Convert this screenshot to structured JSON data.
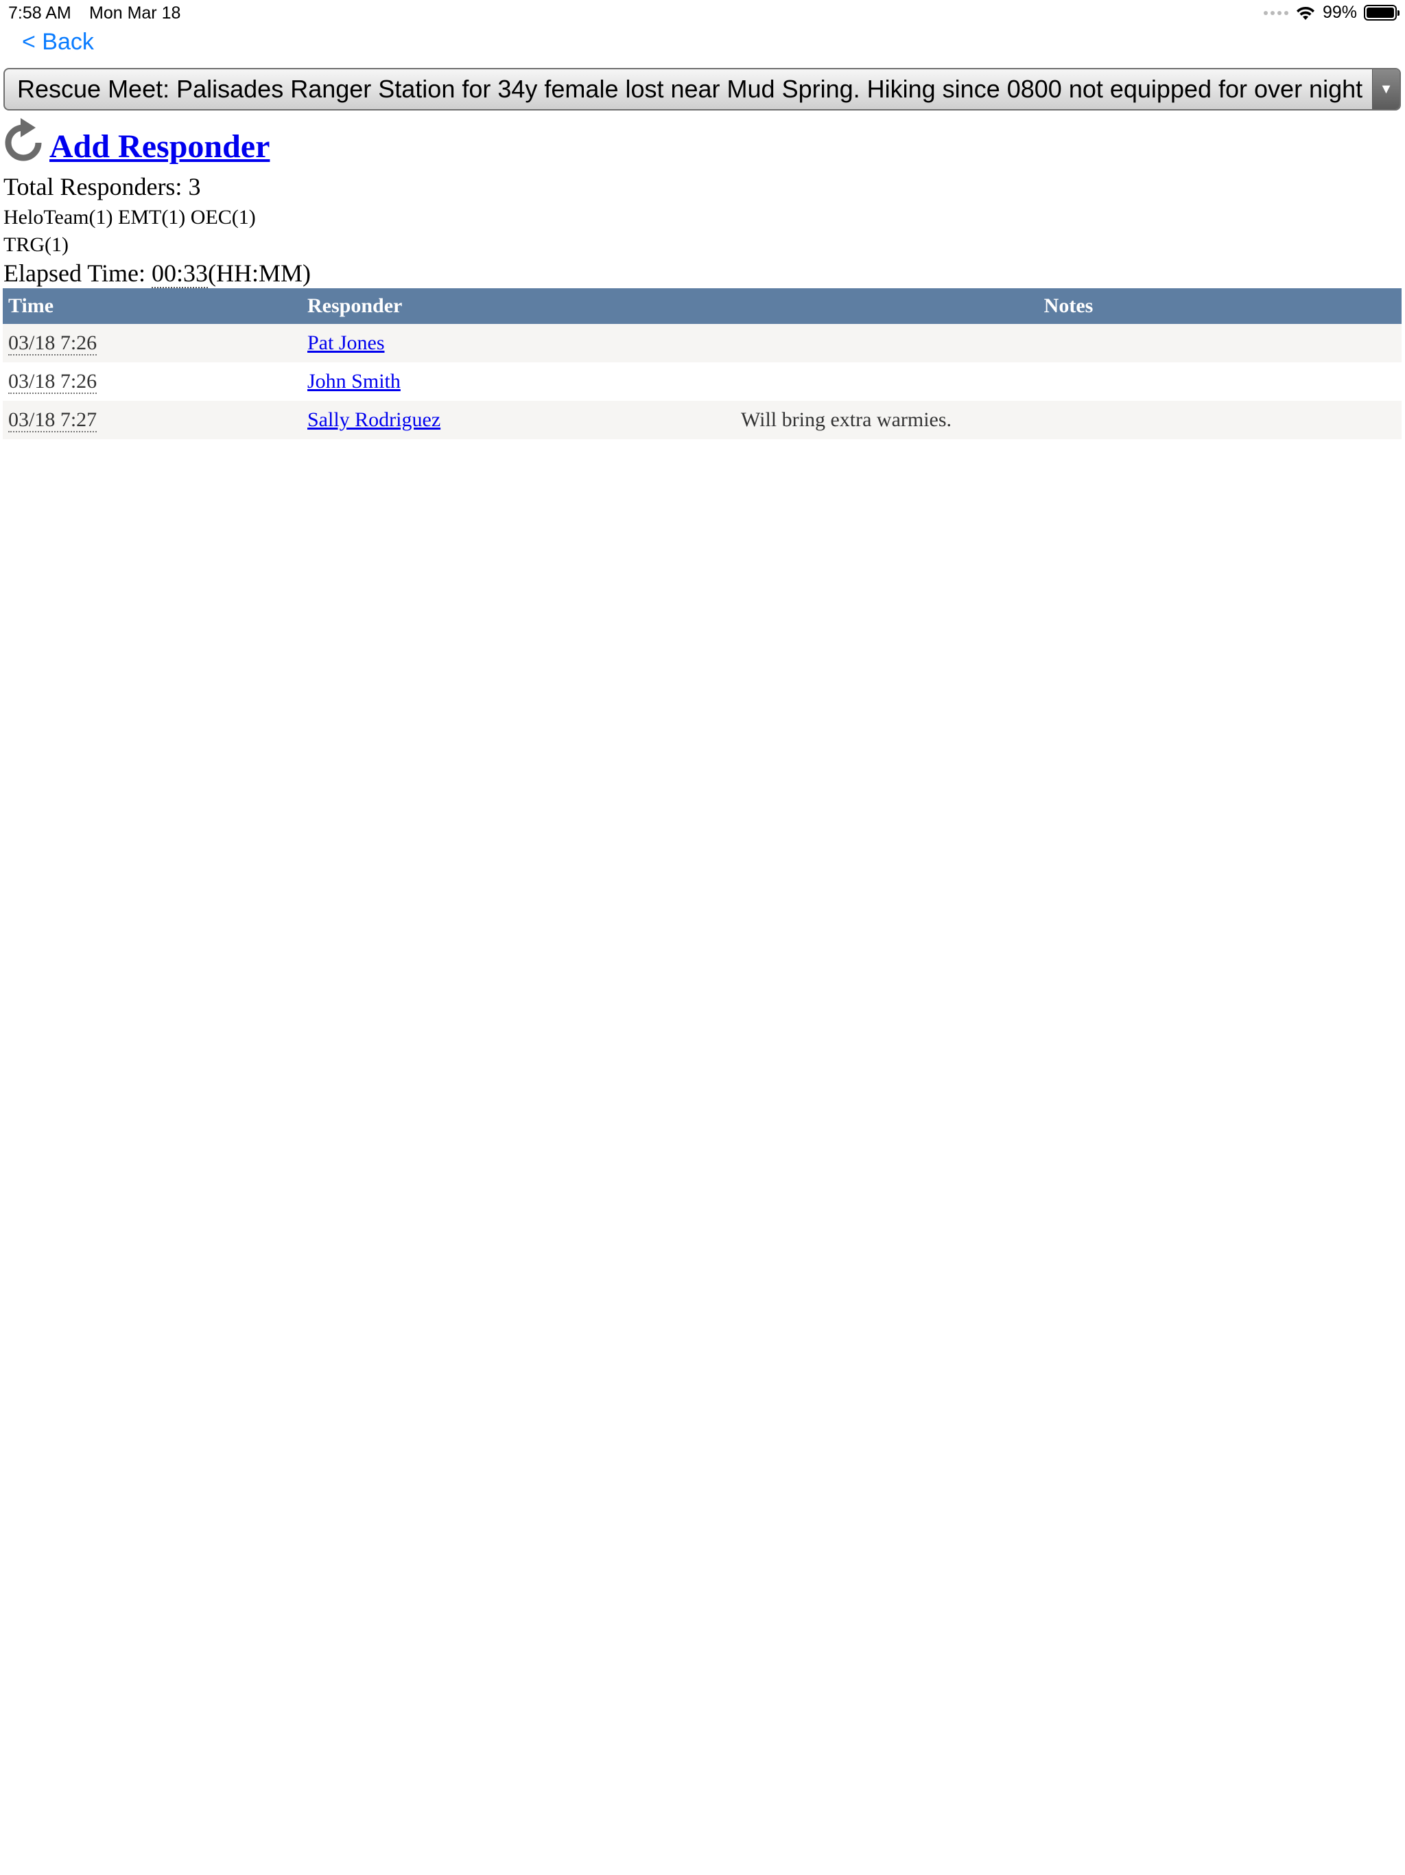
{
  "status_bar": {
    "time": "7:58 AM",
    "date": "Mon Mar 18",
    "battery_percent": "99%",
    "battery_level": 0.99
  },
  "nav": {
    "back_label": "< Back"
  },
  "mission_select": {
    "selected": "Rescue Meet: Palisades Ranger Station for 34y female lost near Mud Spring. Hiking since 0800 not equipped for over night"
  },
  "add_responder": {
    "label": "Add Responder",
    "icon": "refresh-icon"
  },
  "summary": {
    "total_label": "Total Responders: 3",
    "teams_line": "HeloTeam(1) EMT(1) OEC(1) TRG(1)",
    "elapsed_prefix": "Elapsed Time: ",
    "elapsed_value": "00:33",
    "elapsed_suffix": "(HH:MM)"
  },
  "table": {
    "headers": {
      "time": "Time",
      "responder": "Responder",
      "notes": "Notes"
    },
    "rows": [
      {
        "time": "03/18 7:26",
        "responder": "Pat Jones",
        "notes": ""
      },
      {
        "time": "03/18 7:26",
        "responder": "John Smith",
        "notes": ""
      },
      {
        "time": "03/18 7:27",
        "responder": "Sally Rodriguez",
        "notes": "Will bring extra warmies."
      }
    ]
  }
}
